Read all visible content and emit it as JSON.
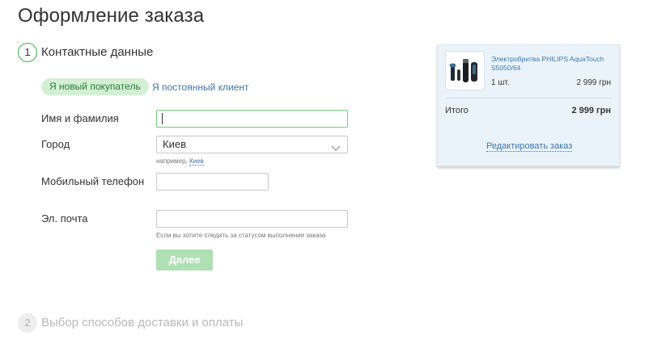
{
  "page": {
    "title": "Оформление заказа"
  },
  "steps": [
    {
      "number": "1",
      "title": "Контактные данные"
    },
    {
      "number": "2",
      "title": "Выбор способов доставки и оплаты"
    }
  ],
  "customer_tabs": {
    "new": "Я новый покупатель",
    "returning": "Я постоянный клиент"
  },
  "form": {
    "name": {
      "label": "Имя и фамилия",
      "value": ""
    },
    "city": {
      "label": "Город",
      "value": "Киев",
      "hint_prefix": "например, ",
      "hint_link": "Киев"
    },
    "phone": {
      "label": "Мобильный телефон",
      "value": ""
    },
    "email": {
      "label": "Эл. почта",
      "value": "",
      "hint": "Если вы хотите следить за статусом выполнения заказа"
    },
    "submit_label": "Далее"
  },
  "cart": {
    "item": {
      "name": "Электробритва PHILIPS AquaTouch S5050/64",
      "quantity": "1 шт.",
      "price": "2 999 грн"
    },
    "total_label": "Итого",
    "total_value": "2 999 грн",
    "edit_label": "Редактировать заказ"
  },
  "colors": {
    "accent_green": "#38b24a",
    "tab_active_bg": "#d3f0d5",
    "link_blue": "#3e77aa",
    "button_disabled_bg": "#aee0b3",
    "cart_bg": "#eaf3fa"
  },
  "icons": {
    "city_select": "chevron-down-icon",
    "product_image": "shaver-icon"
  }
}
